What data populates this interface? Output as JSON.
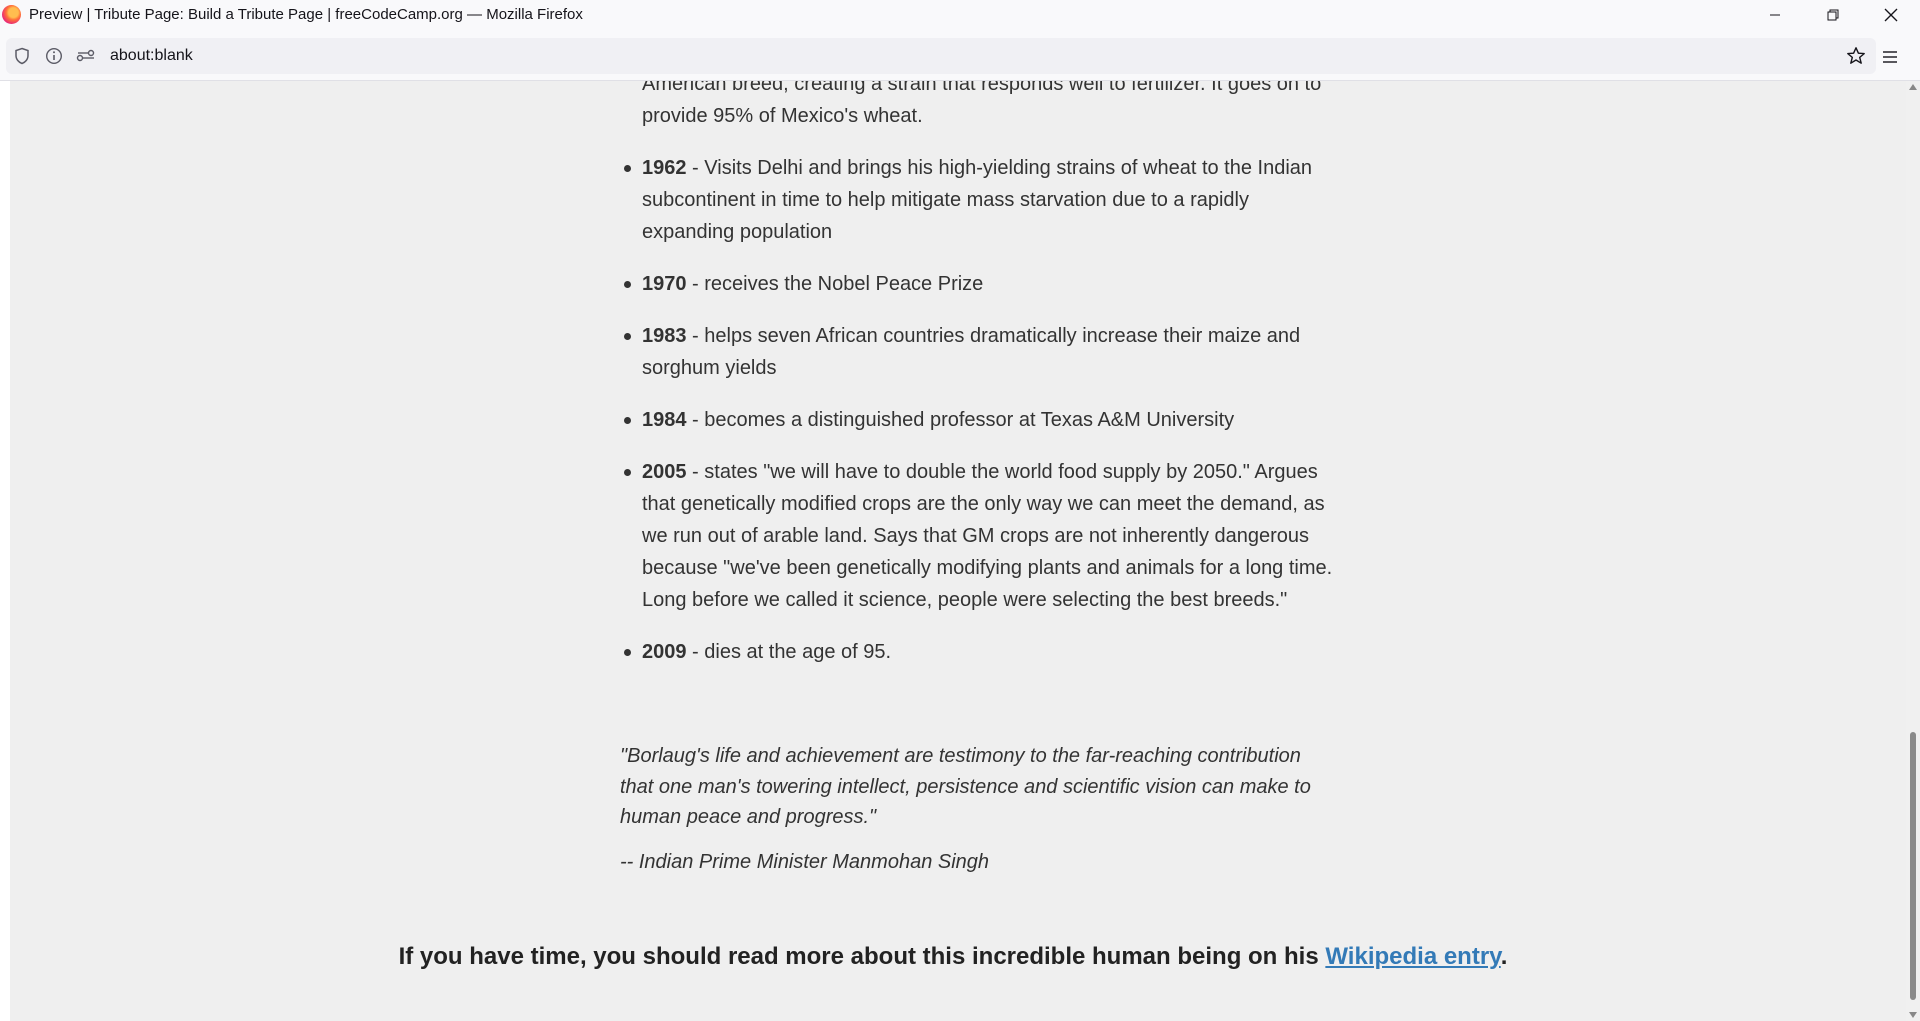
{
  "browser": {
    "window_title": "Preview | Tribute Page: Build a Tribute Page | freeCodeCamp.org — Mozilla Firefox",
    "url": "about:blank",
    "icons": {
      "logo": "firefox-logo-icon",
      "shield": "shield-icon",
      "info": "info-icon",
      "permissions": "permissions-icon",
      "bookmark": "star-icon",
      "menu": "hamburger-menu-icon",
      "minimize": "minimize-icon",
      "restore": "restore-icon",
      "close": "close-icon"
    }
  },
  "page": {
    "partial_item": "American breed, creating a strain that responds well to fertilizer. It goes on to provide 95% of Mexico's wheat.",
    "timeline": [
      {
        "year": "1962",
        "text": " - Visits Delhi and brings his high-yielding strains of wheat to the Indian subcontinent in time to help mitigate mass starvation due to a rapidly expanding population"
      },
      {
        "year": "1970",
        "text": " - receives the Nobel Peace Prize"
      },
      {
        "year": "1983",
        "text": " - helps seven African countries dramatically increase their maize and sorghum yields"
      },
      {
        "year": "1984",
        "text": " - becomes a distinguished professor at Texas A&M University"
      },
      {
        "year": "2005",
        "text": " - states \"we will have to double the world food supply by 2050.\" Argues that genetically modified crops are the only way we can meet the demand, as we run out of arable land. Says that GM crops are not inherently dangerous because \"we've been genetically modifying plants and animals for a long time. Long before we called it science, people were selecting the best breeds.\""
      },
      {
        "year": "2009",
        "text": " - dies at the age of 95."
      }
    ],
    "quote": "\"Borlaug's life and achievement are testimony to the far-reaching contribution that one man's towering intellect, persistence and scientific vision can make to human peace and progress.\"",
    "quote_cite": "-- Indian Prime Minister Manmohan Singh",
    "footer": {
      "prefix": "If you have time, you should read more about this incredible human being on his ",
      "link_text": "Wikipedia entry",
      "suffix": "."
    }
  },
  "colors": {
    "page_background": "#efefef",
    "text": "#333333",
    "link": "#337ab7"
  }
}
